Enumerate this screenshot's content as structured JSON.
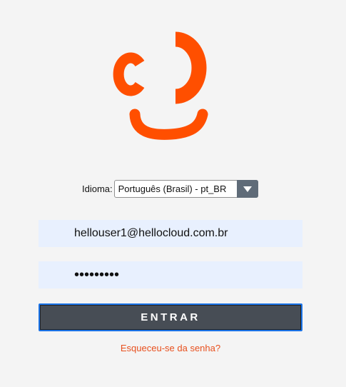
{
  "brand": {
    "logo_icon": "hellocloud-smile-logo-icon",
    "accent_color": "#ff4f00"
  },
  "language": {
    "label": "Idioma:",
    "selected": "Português (Brasil) - pt_BR",
    "dropdown_icon": "caret-down-icon"
  },
  "login": {
    "email_value": "hellouser1@hellocloud.com.br",
    "password_value": "•••••••••",
    "submit_label": "ENTRAR",
    "forgot_link": "Esqueceu-se da senha?"
  }
}
